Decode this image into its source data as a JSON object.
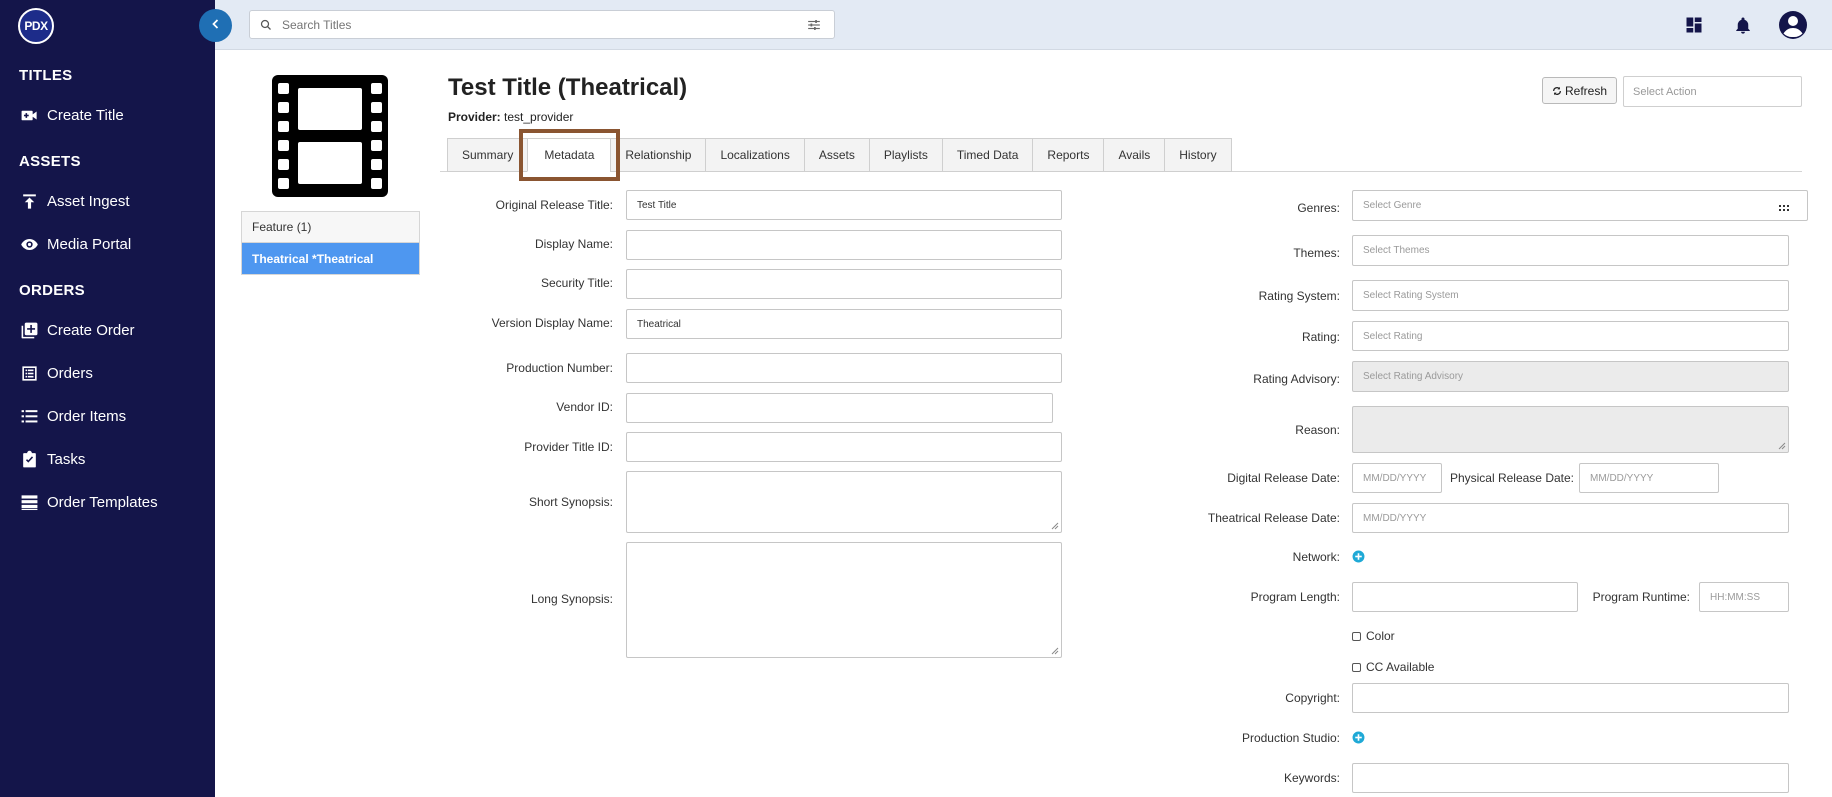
{
  "sidebar": {
    "logo": "PDX",
    "sections": {
      "titles": "TITLES",
      "assets": "ASSETS",
      "orders": "ORDERS"
    },
    "items": {
      "create_title": "Create Title",
      "asset_ingest": "Asset Ingest",
      "media_portal": "Media Portal",
      "create_order": "Create Order",
      "orders": "Orders",
      "order_items": "Order Items",
      "tasks": "Tasks",
      "order_templates": "Order Templates"
    }
  },
  "topbar": {
    "search_placeholder": "Search Titles",
    "icons": [
      "dashboard-icon",
      "bell-icon",
      "account-icon"
    ]
  },
  "title": {
    "name": "Test Title (Theatrical)",
    "provider_label": "Provider:",
    "provider_value": "test_provider",
    "refresh_label": "Refresh",
    "action_placeholder": "Select Action"
  },
  "variants": [
    {
      "label": "Feature (1)"
    },
    {
      "label": "Theatrical *Theatrical"
    }
  ],
  "tabs": [
    "Summary",
    "Metadata",
    "Relationship",
    "Localizations",
    "Assets",
    "Playlists",
    "Timed Data",
    "Reports",
    "Avails",
    "History"
  ],
  "active_tab": "Metadata",
  "left_form": {
    "original_release_title": {
      "label": "Original Release Title:",
      "value": "Test Title"
    },
    "display_name": {
      "label": "Display Name:",
      "value": ""
    },
    "security_title": {
      "label": "Security Title:",
      "value": ""
    },
    "version_display_name": {
      "label": "Version Display Name:",
      "value": "Theatrical"
    },
    "production_number": {
      "label": "Production Number:",
      "value": ""
    },
    "vendor_id": {
      "label": "Vendor ID:",
      "value": ""
    },
    "provider_title_id": {
      "label": "Provider Title ID:",
      "value": ""
    },
    "short_synopsis": {
      "label": "Short Synopsis:",
      "value": ""
    },
    "long_synopsis": {
      "label": "Long Synopsis:",
      "value": ""
    }
  },
  "right_form": {
    "genres": {
      "label": "Genres:",
      "placeholder": "Select Genre"
    },
    "themes": {
      "label": "Themes:",
      "placeholder": "Select Themes"
    },
    "rating_system": {
      "label": "Rating System:",
      "placeholder": "Select Rating System"
    },
    "rating": {
      "label": "Rating:",
      "placeholder": "Select Rating"
    },
    "rating_advisory": {
      "label": "Rating Advisory:",
      "placeholder": "Select Rating Advisory"
    },
    "reason": {
      "label": "Reason:",
      "value": ""
    },
    "digital_release_date": {
      "label": "Digital Release Date:",
      "placeholder": "MM/DD/YYYY"
    },
    "physical_release_date": {
      "label": "Physical Release Date:",
      "placeholder": "MM/DD/YYYY"
    },
    "theatrical_release_date": {
      "label": "Theatrical Release Date:",
      "placeholder": "MM/DD/YYYY"
    },
    "network": {
      "label": "Network:"
    },
    "program_length": {
      "label": "Program Length:",
      "value": ""
    },
    "program_runtime": {
      "label": "Program Runtime:",
      "placeholder": "HH:MM:SS"
    },
    "color": {
      "label": "Color",
      "checked": false
    },
    "cc_available": {
      "label": "CC Available",
      "checked": false
    },
    "copyright": {
      "label": "Copyright:",
      "value": ""
    },
    "production_studio": {
      "label": "Production Studio:"
    },
    "keywords": {
      "label": "Keywords:",
      "value": ""
    }
  },
  "colors": {
    "sidebar_bg": "#14154a",
    "topbar_bg": "#e3eaf4",
    "accent_blue": "#4e97f0",
    "collapse_btn": "#1f6fb4",
    "highlight_border": "#8a5531",
    "plus_icon": "#1fa9d6"
  }
}
